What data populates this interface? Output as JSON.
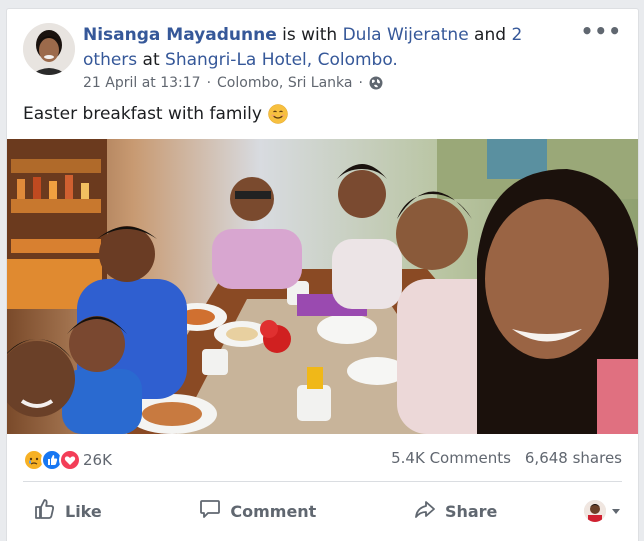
{
  "post": {
    "author": "Nisanga Mayadunne",
    "with_text": " is with ",
    "tagged": "Dula Wijeratne",
    "and_text": " and ",
    "others": "2 others",
    "at_text": " at ",
    "place": "Shangri-La Hotel, Colombo.",
    "date": "21 April at 13:17",
    "separator": "·",
    "location": "Colombo, Sri Lanka",
    "separator2": "·",
    "text": "Easter breakfast with family",
    "more_menu": "•••"
  },
  "stats": {
    "reaction_count": "26K",
    "comments": "5.4K Comments",
    "shares": "6,648 shares"
  },
  "actions": {
    "like": "Like",
    "comment": "Comment",
    "share": "Share"
  },
  "colors": {
    "link": "#365899",
    "secondary": "#616770",
    "like_blue": "#1877f2",
    "love_red": "#f33e58",
    "sad_yellow": "#f7b125"
  },
  "icons": {
    "globe": "globe-icon",
    "emoji": "smiling-face-emoji",
    "more": "more-options-icon",
    "like": "thumbs-up-icon",
    "comment": "comment-bubble-icon",
    "share": "share-arrow-icon",
    "audience_caret": "caret-down-icon"
  }
}
